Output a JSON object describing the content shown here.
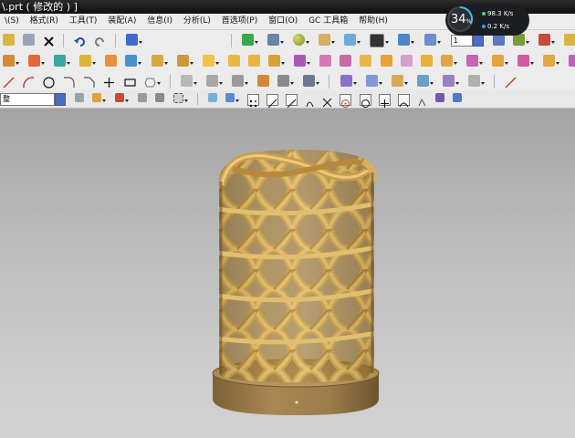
{
  "window": {
    "title": "\\.prt  ( 修改的 ) ]"
  },
  "menu": [
    {
      "label": "\\(S)"
    },
    {
      "label": "格式(R)"
    },
    {
      "label": "工具(T)"
    },
    {
      "label": "装配(A)"
    },
    {
      "label": "信息(I)"
    },
    {
      "label": "分析(L)"
    },
    {
      "label": "首选项(P)"
    },
    {
      "label": "窗口(O)"
    },
    {
      "label": "GC 工具箱"
    },
    {
      "label": "帮助(H)"
    }
  ],
  "toolbar": {
    "layer_value": "1",
    "filter_value": "整"
  },
  "speed_widget": {
    "percent": "34",
    "percent_unit": "%",
    "upload": "98.3",
    "upload_unit": "K/s",
    "download": "0.2",
    "download_unit": "K/s"
  },
  "colors": {
    "model_gold": "#d3aa55",
    "base_wood": "#9c7d4b",
    "viewport_top": "#a4a4a4",
    "viewport_bottom": "#d2d2d2"
  }
}
